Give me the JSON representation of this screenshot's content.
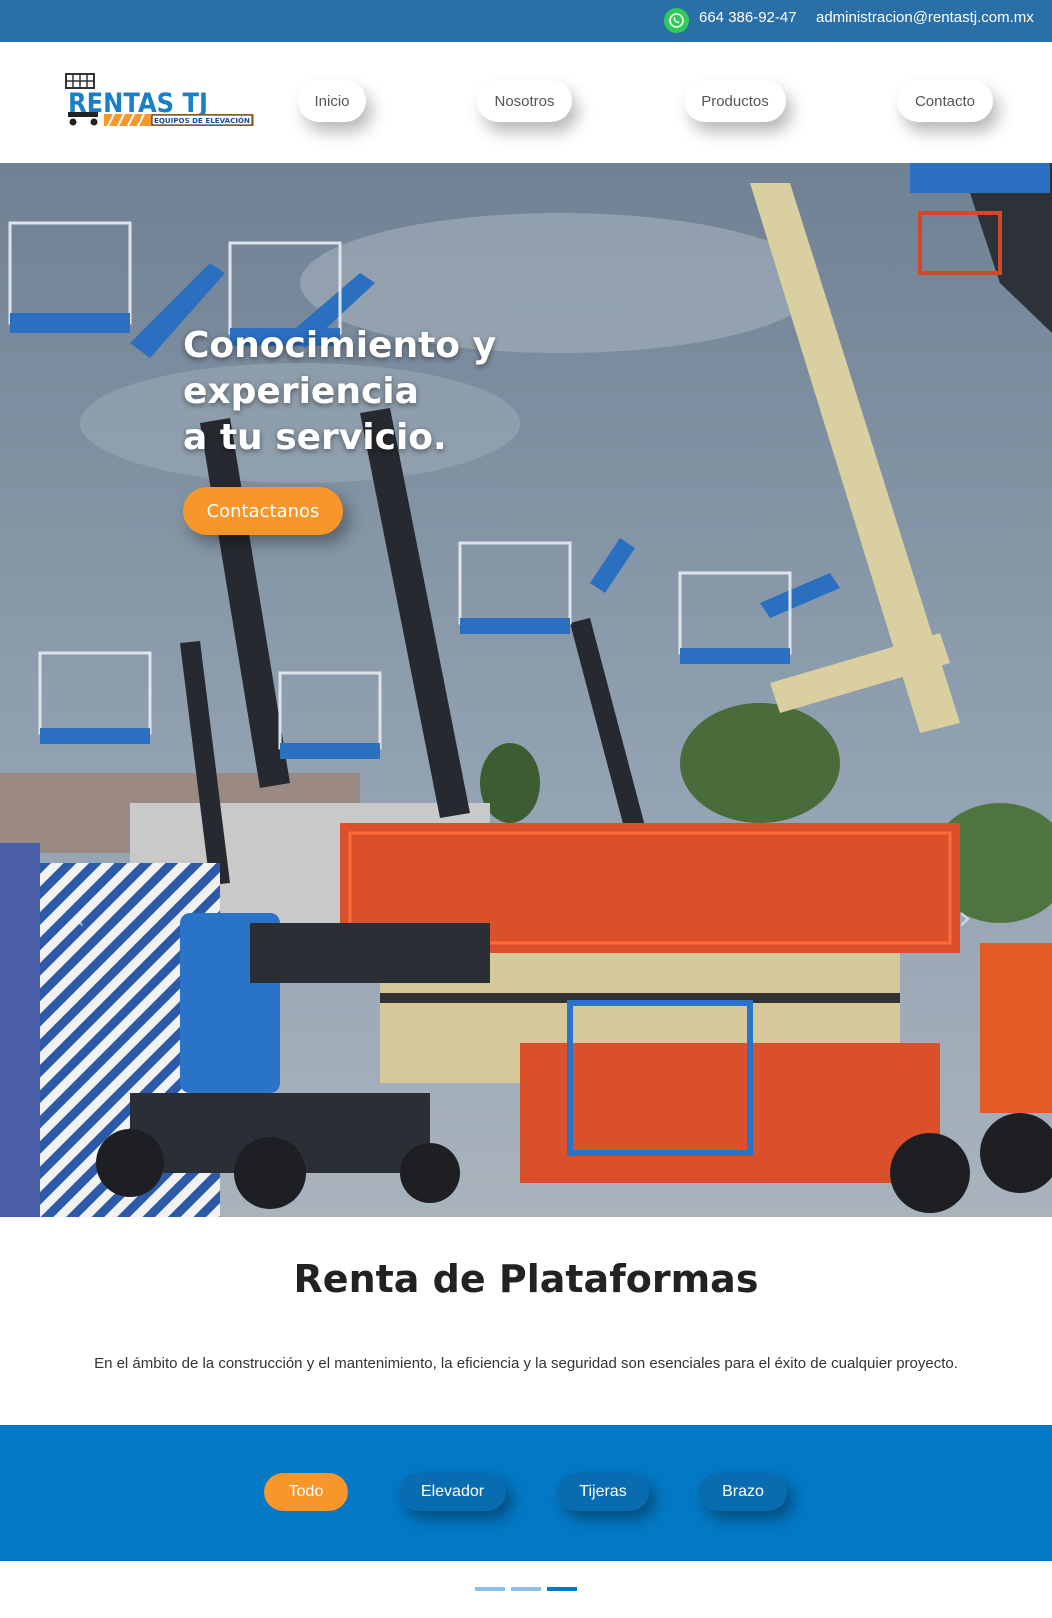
{
  "topbar": {
    "phone": "664 386-92-47",
    "email": "administracion@rentastj.com.mx",
    "whatsapp_icon": "whatsapp-icon"
  },
  "logo": {
    "text": "RENTAS TJ",
    "subtext": "EQUIPOS DE ELEVACIÓN"
  },
  "nav": {
    "items": [
      {
        "label": "Inicio"
      },
      {
        "label": "Nosotros"
      },
      {
        "label": "Productos"
      },
      {
        "label": "Contacto"
      }
    ]
  },
  "hero": {
    "title_line1": "Conocimiento y experiencia",
    "title_line2": "a tu servicio.",
    "cta_label": "Contactanos",
    "prev_icon": "chevron-left-icon",
    "next_icon": "chevron-right-icon"
  },
  "section": {
    "title": "Renta de Plataformas",
    "text": "En el ámbito de la construcción y el mantenimiento, la eficiencia y la seguridad son esenciales para el éxito de cualquier proyecto."
  },
  "filters": {
    "items": [
      {
        "label": "Todo",
        "active": true
      },
      {
        "label": "Elevador",
        "active": false
      },
      {
        "label": "Tijeras",
        "active": false
      },
      {
        "label": "Brazo",
        "active": false
      }
    ]
  },
  "colors": {
    "topbar": "#2a6fa6",
    "accent": "#f7962a",
    "filterbar": "#0378c4",
    "whatsapp": "#2ecc55"
  }
}
